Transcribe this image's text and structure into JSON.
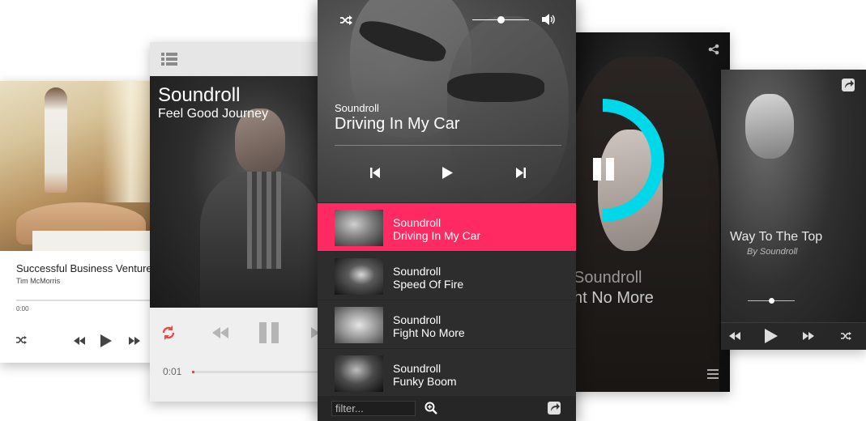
{
  "card1": {
    "title": "Successful Business Venture",
    "artist": "Tim McMorris",
    "time": "0:00"
  },
  "card2": {
    "artist": "Soundroll",
    "title": "Feel Good Journey",
    "time": "0:01",
    "accent": "#e84a4a"
  },
  "card3": {
    "now_playing": {
      "artist": "Soundroll",
      "title": "Driving In My Car"
    },
    "volume": 0.5,
    "playlist": [
      {
        "artist": "Soundroll",
        "title": "Driving In My Car",
        "active": true
      },
      {
        "artist": "Soundroll",
        "title": "Speed Of Fire",
        "active": false
      },
      {
        "artist": "Soundroll",
        "title": "Fight No More",
        "active": false
      },
      {
        "artist": "Soundroll",
        "title": "Funky Boom",
        "active": false
      }
    ],
    "filter_placeholder": "filter...",
    "accent": "#fe2a61"
  },
  "card4": {
    "artist": "Soundroll",
    "title": "ht No More",
    "progress": 0.5,
    "ring_color": "#00d7e8"
  },
  "card5": {
    "title": "Way To The Top",
    "byline": "By Soundroll",
    "volume": 0.5
  },
  "icons": [
    "shuffle-icon",
    "volume-icon",
    "prev-icon",
    "play-icon",
    "next-icon",
    "pause-icon",
    "share-icon",
    "menu-icon",
    "list-icon",
    "repeat-icon",
    "rewind-icon",
    "forward-icon",
    "search-icon",
    "external-icon"
  ]
}
